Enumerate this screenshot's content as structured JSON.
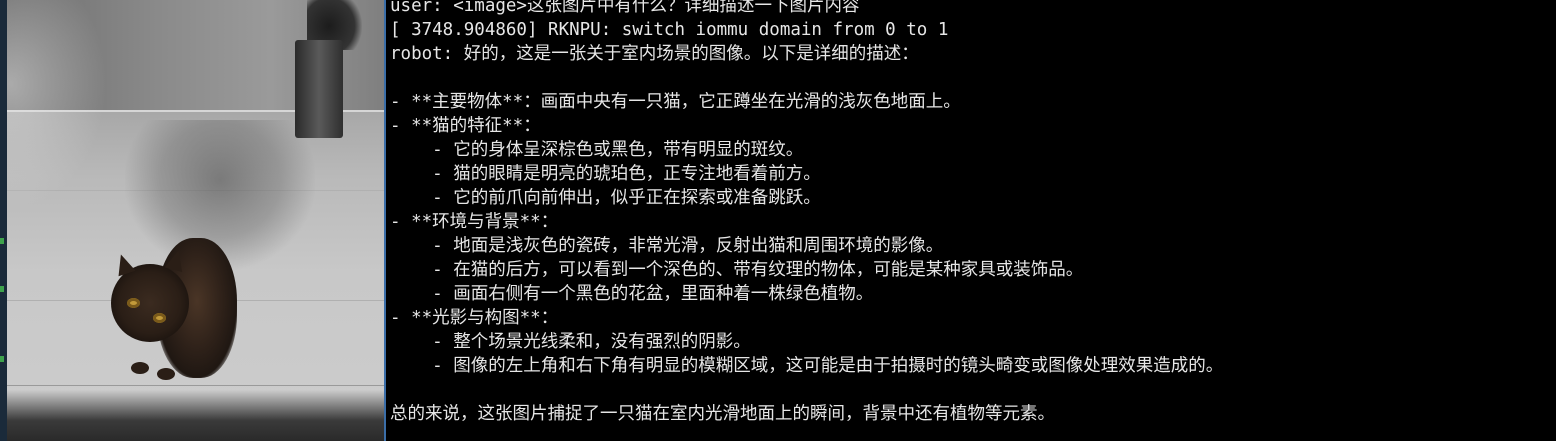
{
  "photo": {
    "description_tag": "cat-photo"
  },
  "terminal": {
    "lines": [
      "user: <image>这张图片中有什么？详细描述一下图片内容",
      "[ 3748.904860] RKNPU: switch iommu domain from 0 to 1",
      "robot: 好的，这是一张关于室内场景的图像。以下是详细的描述：",
      "",
      "- **主要物体**：画面中央有一只猫，它正蹲坐在光滑的浅灰色地面上。",
      "- **猫的特征**：",
      "    - 它的身体呈深棕色或黑色，带有明显的斑纹。",
      "    - 猫的眼睛是明亮的琥珀色，正专注地看着前方。",
      "    - 它的前爪向前伸出，似乎正在探索或准备跳跃。",
      "- **环境与背景**：",
      "    - 地面是浅灰色的瓷砖，非常光滑，反射出猫和周围环境的影像。",
      "    - 在猫的后方，可以看到一个深色的、带有纹理的物体，可能是某种家具或装饰品。",
      "    - 画面右侧有一个黑色的花盆，里面种着一株绿色植物。",
      "- **光影与构图**：",
      "    - 整个场景光线柔和，没有强烈的阴影。",
      "    - 图像的左上角和右下角有明显的模糊区域，这可能是由于拍摄时的镜头畸变或图像处理效果造成的。",
      "",
      "总的来说，这张图片捕捉了一只猫在室内光滑地面上的瞬间，背景中还有植物等元素。"
    ]
  },
  "colors": {
    "terminal_bg": "#000000",
    "terminal_fg": "#e6e6e6",
    "divider": "#3b6ea8"
  }
}
